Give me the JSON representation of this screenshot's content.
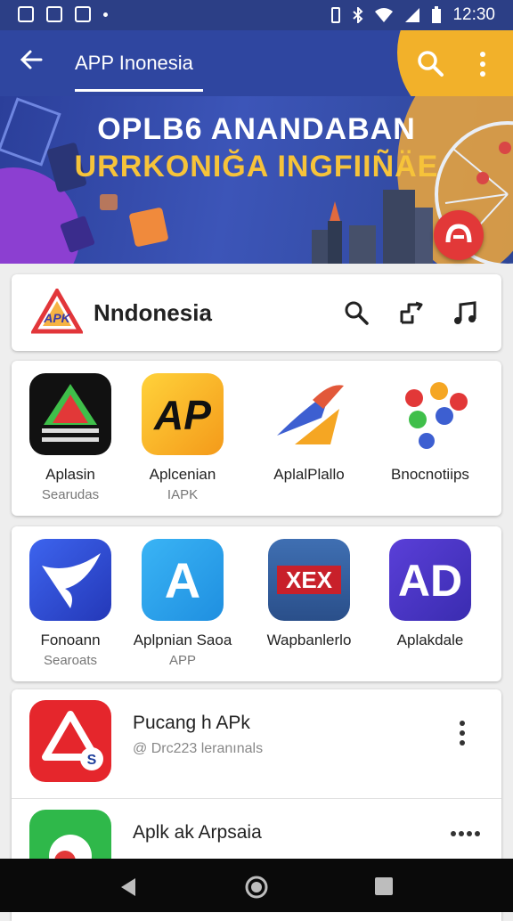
{
  "status_bar": {
    "time": "12:30"
  },
  "app_bar": {
    "title": "APP Inonesia"
  },
  "banner": {
    "line1": "OPLB6 ANANDABAN",
    "line2": "URRKONIĞA INGFIIÑÄE"
  },
  "brand": {
    "name": "Nndonesia",
    "logo_text": "APK"
  },
  "apps_row1": [
    {
      "name": "Aplasin",
      "sub": "Searudas",
      "icon_text": ""
    },
    {
      "name": "Aplcenian",
      "sub": "IAPK",
      "icon_text": "AP"
    },
    {
      "name": "AplalPlallo",
      "sub": "",
      "icon_text": ""
    },
    {
      "name": "Bnocnotiips",
      "sub": "",
      "icon_text": ""
    }
  ],
  "apps_row2": [
    {
      "name": "Fonoann",
      "sub": "Searoats",
      "icon_text": ""
    },
    {
      "name": "Aplpnian Saoa",
      "sub": "APP",
      "icon_text": "A"
    },
    {
      "name": "Wapbanlerlo",
      "sub": "",
      "icon_text": "XEX"
    },
    {
      "name": "Aplakdale",
      "sub": "",
      "icon_text": "AD"
    }
  ],
  "list": [
    {
      "title": "Pucang h APk",
      "subtitle": "@ Drc223 leranınals"
    },
    {
      "title": "Aplk ak Arpsaia",
      "subtitle": ""
    }
  ],
  "colors": {
    "primary": "#2f46a0",
    "accent": "#f2b12a",
    "fab": "#e23838"
  }
}
